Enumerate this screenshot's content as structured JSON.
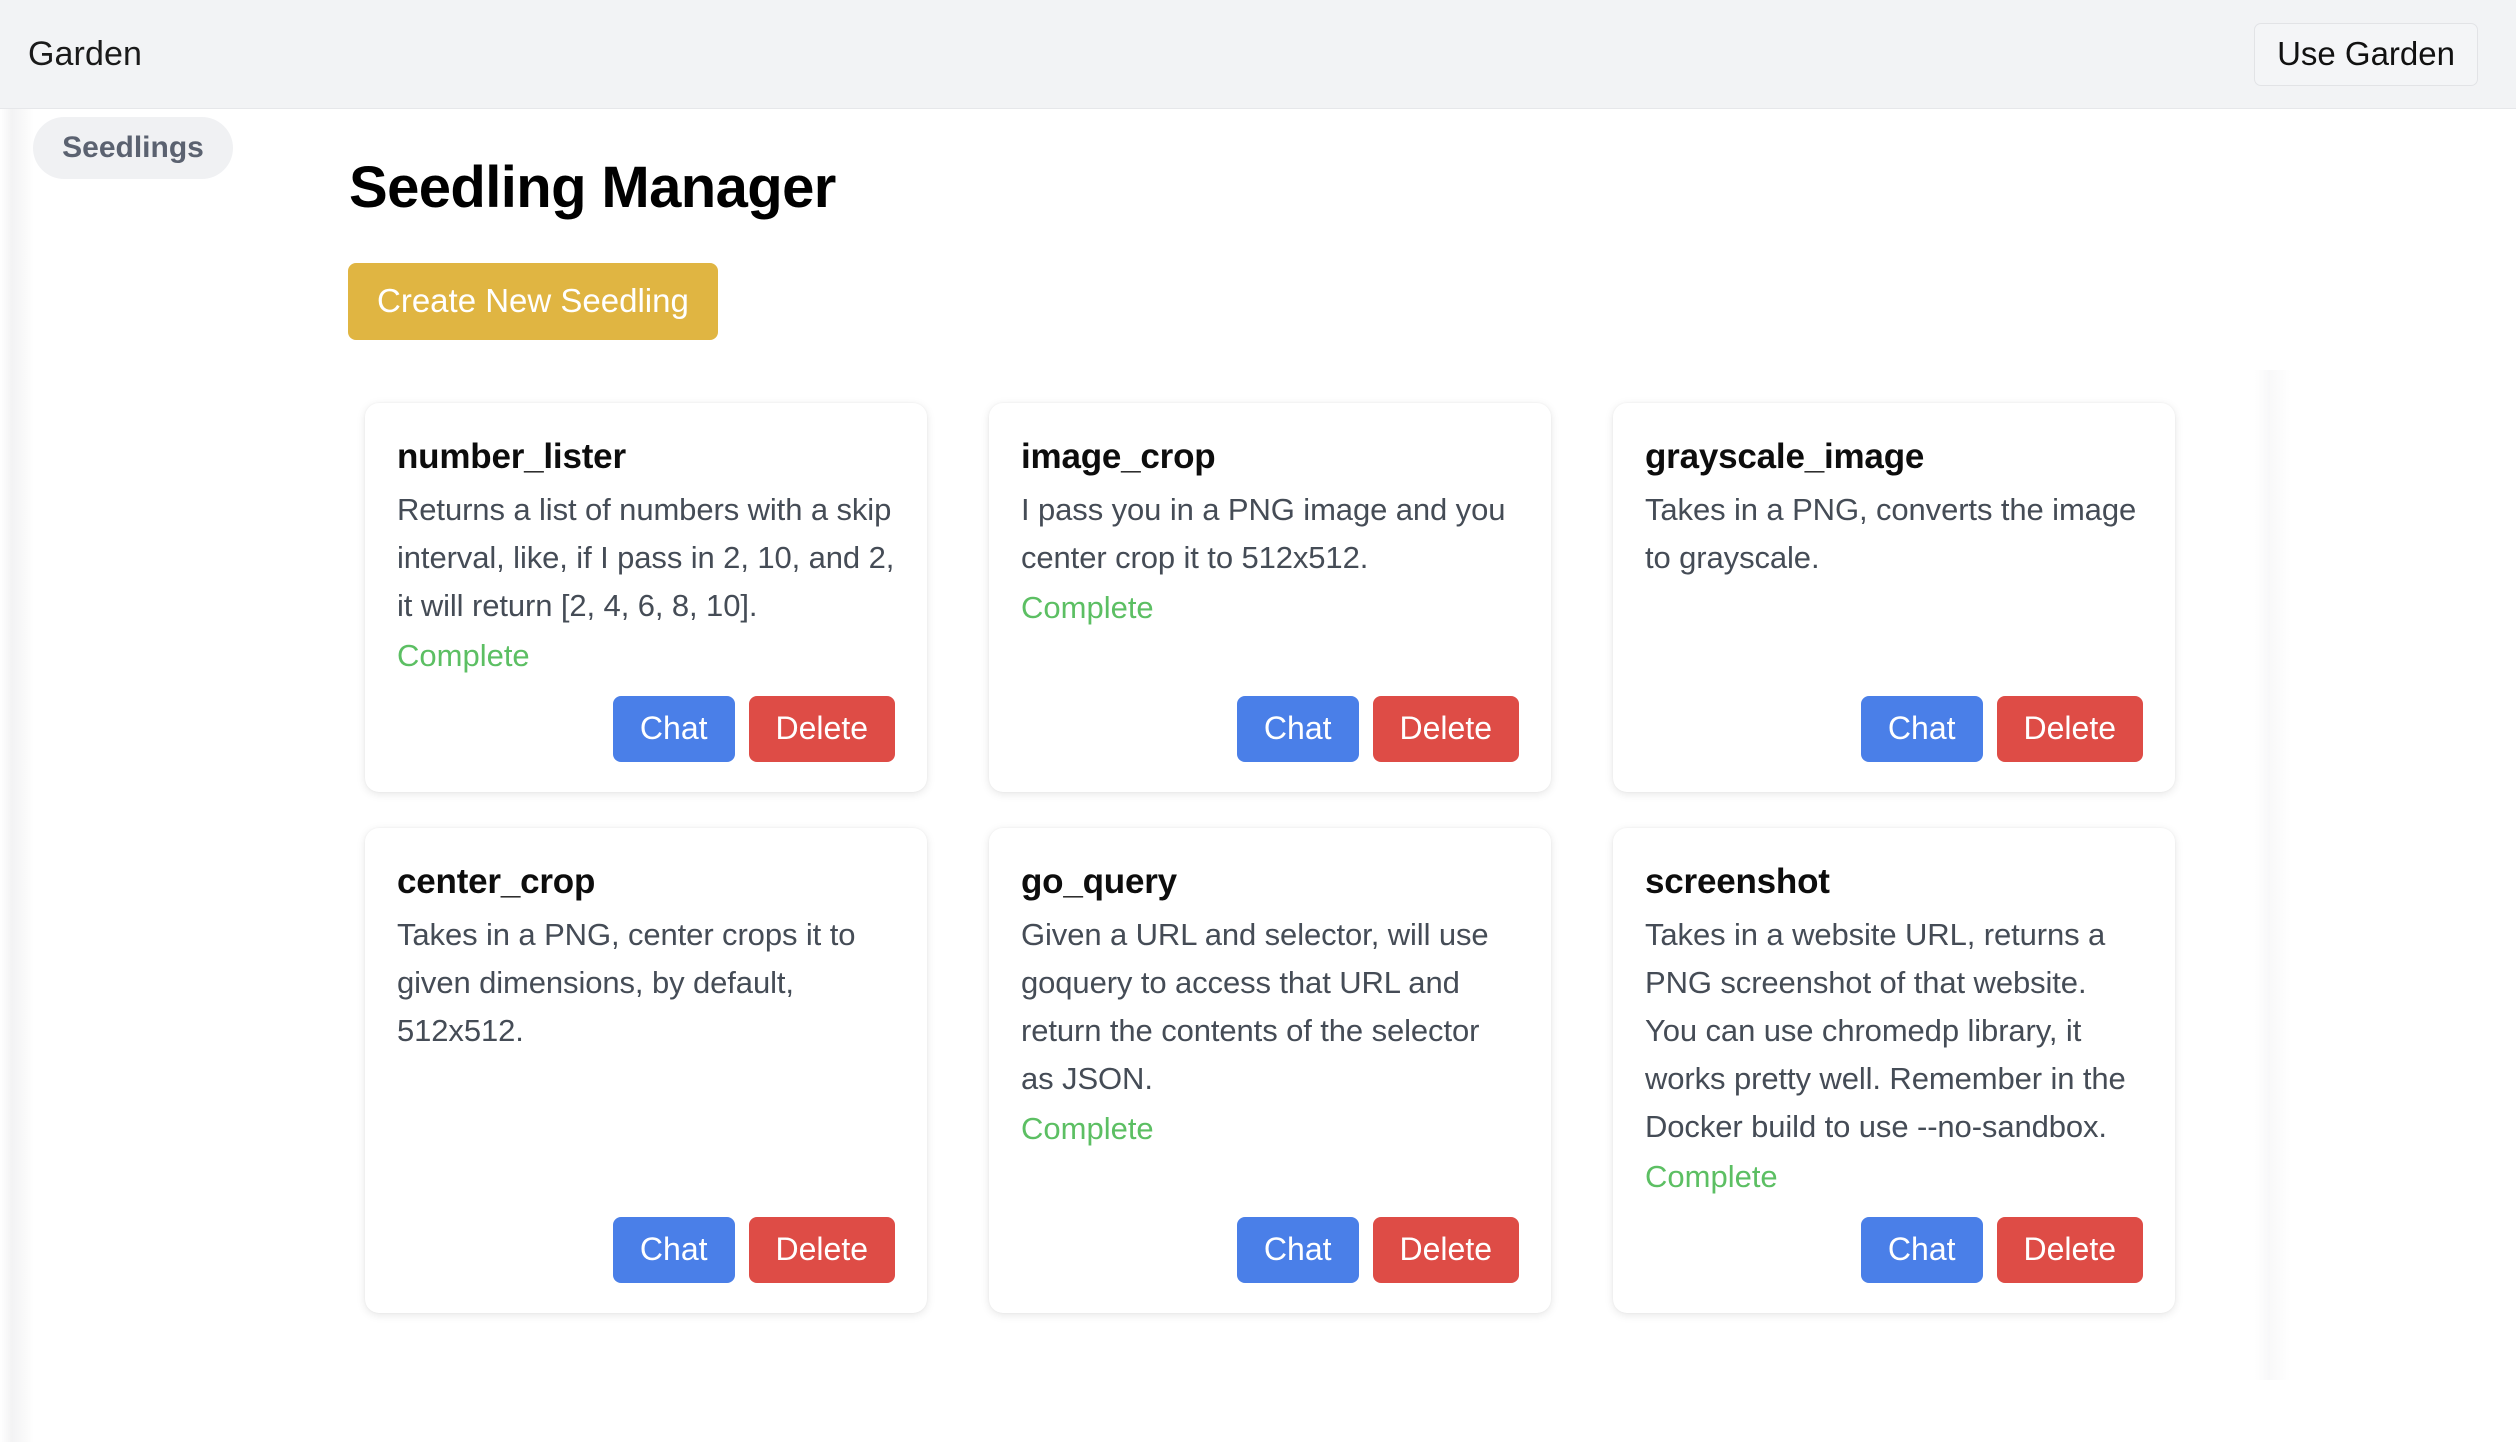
{
  "topbar": {
    "brand": "Garden",
    "use_garden_label": "Use Garden"
  },
  "sidebar": {
    "items": [
      {
        "label": "Seedlings"
      }
    ]
  },
  "main": {
    "page_title": "Seedling Manager",
    "create_label": "Create New Seedling",
    "chat_label": "Chat",
    "delete_label": "Delete",
    "status_complete": "Complete"
  },
  "colors": {
    "topbar_bg": "#f2f3f5",
    "create_button": "#e0b542",
    "chat_button": "#4a7fe8",
    "delete_button": "#de4c46",
    "status_complete": "#5cbf63",
    "pill_bg": "#f0f1f3",
    "card_bg": "#ffffff",
    "page_bg": "#ffffff"
  },
  "cards": [
    {
      "name": "number_lister",
      "description": "Returns a list of numbers with a skip interval, like, if I pass in 2, 10, and 2, it will return [2, 4, 6, 8, 10].",
      "status": "Complete",
      "chat": "Chat",
      "delete": "Delete"
    },
    {
      "name": "image_crop",
      "description": "I pass you in a PNG image and you center crop it to 512x512.",
      "status": "Complete",
      "chat": "Chat",
      "delete": "Delete"
    },
    {
      "name": "grayscale_image",
      "description": "Takes in a PNG, converts the image to grayscale.",
      "status": "",
      "chat": "Chat",
      "delete": "Delete"
    },
    {
      "name": "center_crop",
      "description": "Takes in a PNG, center crops it to given dimensions, by default, 512x512.",
      "status": "",
      "chat": "Chat",
      "delete": "Delete"
    },
    {
      "name": "go_query",
      "description": "Given a URL and selector, will use goquery to access that URL and return the contents of the selector as JSON.",
      "status": "Complete",
      "chat": "Chat",
      "delete": "Delete"
    },
    {
      "name": "screenshot",
      "description": "Takes in a website URL, returns a PNG screenshot of that website. You can use chromedp library, it works pretty well. Remember in the Docker build to use --no-sandbox.",
      "status": "Complete",
      "chat": "Chat",
      "delete": "Delete"
    }
  ]
}
